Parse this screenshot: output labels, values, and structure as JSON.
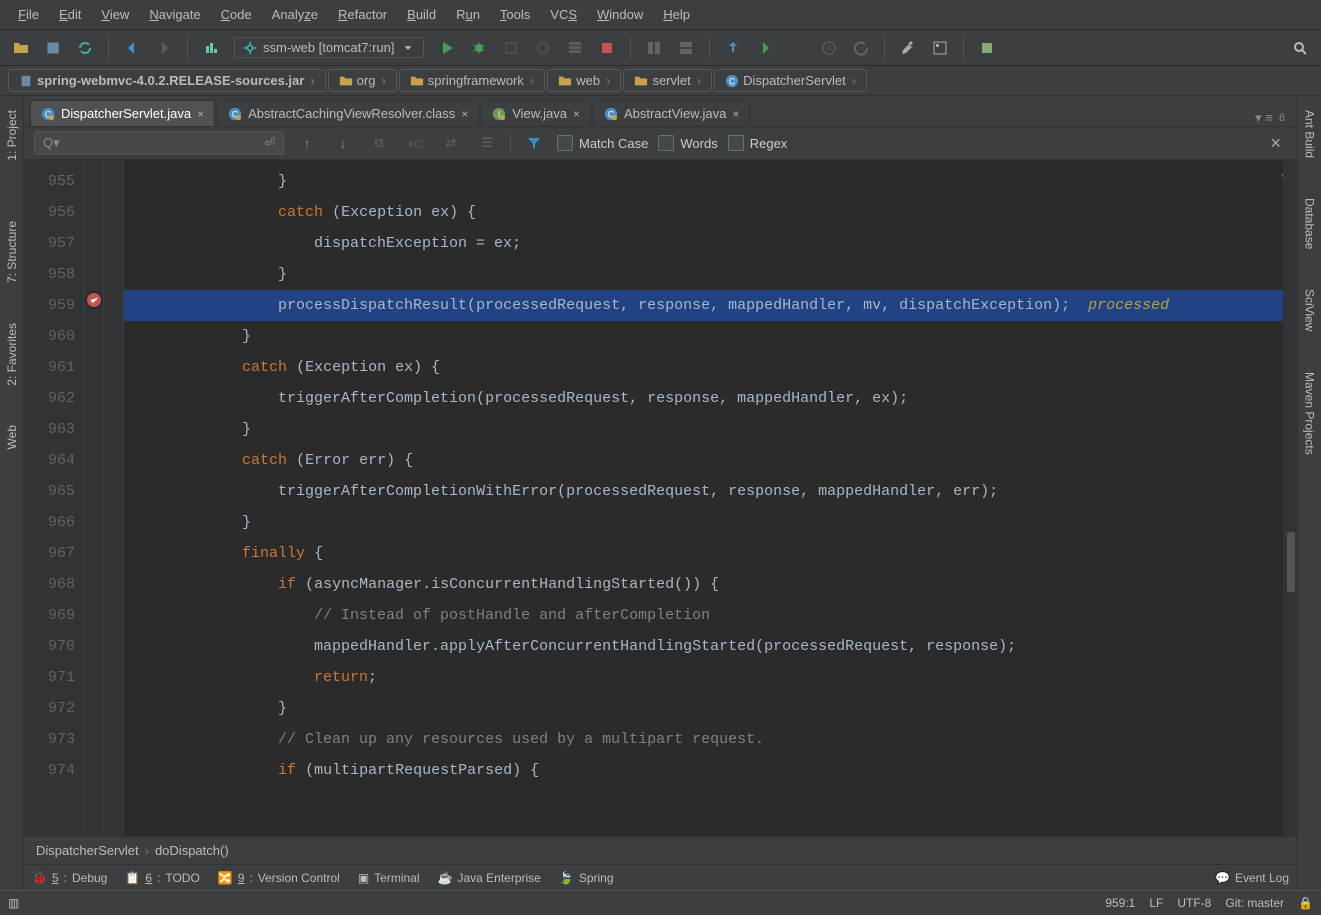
{
  "menu": {
    "file": "File",
    "edit": "Edit",
    "view": "View",
    "navigate": "Navigate",
    "code": "Code",
    "analyze": "Analyze",
    "refactor": "Refactor",
    "build": "Build",
    "run": "Run",
    "tools": "Tools",
    "vcs": "VCS",
    "window": "Window",
    "help": "Help"
  },
  "runConfig": {
    "label": "ssm-web [tomcat7:run]"
  },
  "breadcrumbs": [
    {
      "label": "spring-webmvc-4.0.2.RELEASE-sources.jar",
      "icon": "jar"
    },
    {
      "label": "org",
      "icon": "folder"
    },
    {
      "label": "springframework",
      "icon": "folder"
    },
    {
      "label": "web",
      "icon": "folder"
    },
    {
      "label": "servlet",
      "icon": "folder"
    },
    {
      "label": "DispatcherServlet",
      "icon": "class"
    }
  ],
  "tabs": [
    {
      "label": "DispatcherServlet.java",
      "active": true,
      "icon": "class-lock"
    },
    {
      "label": "AbstractCachingViewResolver.class",
      "active": false,
      "icon": "class-lock"
    },
    {
      "label": "View.java",
      "active": false,
      "icon": "interface-lock"
    },
    {
      "label": "AbstractView.java",
      "active": false,
      "icon": "class-lock"
    }
  ],
  "search": {
    "placeholder": "",
    "matchCase": "Match Case",
    "words": "Words",
    "regex": "Regex"
  },
  "code": {
    "startLine": 955,
    "lines": [
      {
        "n": 955,
        "ind": 16,
        "html": "<span class='pun'>}</span>"
      },
      {
        "n": 956,
        "ind": 16,
        "html": "<span class='kw'>catch</span> <span class='pun'>(Exception ex) {</span>"
      },
      {
        "n": 957,
        "ind": 20,
        "html": "<span class='txt'>dispatchException = ex;</span>"
      },
      {
        "n": 958,
        "ind": 16,
        "html": "<span class='pun'>}</span>"
      },
      {
        "n": 959,
        "ind": 16,
        "hl": true,
        "mark": "error",
        "html": "<span class='txt'>processDispatchResult(processedRequest, response, mappedHandler, mv, dispatchException);  </span><span class='str-hint'>processed</span>"
      },
      {
        "n": 960,
        "ind": 12,
        "html": "<span class='pun'>}</span>"
      },
      {
        "n": 961,
        "ind": 12,
        "html": "<span class='kw'>catch</span> <span class='pun'>(Exception ex) {</span>"
      },
      {
        "n": 962,
        "ind": 16,
        "html": "<span class='txt'>triggerAfterCompletion(processedRequest, response, mappedHandler, ex);</span>"
      },
      {
        "n": 963,
        "ind": 12,
        "html": "<span class='pun'>}</span>"
      },
      {
        "n": 964,
        "ind": 12,
        "html": "<span class='kw'>catch</span> <span class='pun'>(Error err) {</span>"
      },
      {
        "n": 965,
        "ind": 16,
        "html": "<span class='txt'>triggerAfterCompletionWithError(processedRequest, response, mappedHandler, err);</span>"
      },
      {
        "n": 966,
        "ind": 12,
        "html": "<span class='pun'>}</span>"
      },
      {
        "n": 967,
        "ind": 12,
        "html": "<span class='kw'>finally</span> <span class='pun'>{</span>"
      },
      {
        "n": 968,
        "ind": 16,
        "html": "<span class='kw'>if</span> <span class='pun'>(asyncManager.isConcurrentHandlingStarted()) {</span>"
      },
      {
        "n": 969,
        "ind": 20,
        "html": "<span class='cmt'>// Instead of postHandle and afterCompletion</span>"
      },
      {
        "n": 970,
        "ind": 20,
        "html": "<span class='txt'>mappedHandler.applyAfterConcurrentHandlingStarted(processedRequest, response);</span>"
      },
      {
        "n": 971,
        "ind": 20,
        "html": "<span class='kw'>return</span><span class='pun'>;</span>"
      },
      {
        "n": 972,
        "ind": 16,
        "html": "<span class='pun'>}</span>"
      },
      {
        "n": 973,
        "ind": 16,
        "html": "<span class='cmt'>// Clean up any resources used by a multipart request.</span>"
      },
      {
        "n": 974,
        "ind": 16,
        "html": "<span class='kw'>if</span> <span class='pun'>(multipartRequestParsed) {</span>"
      }
    ]
  },
  "crumbPath": {
    "class": "DispatcherServlet",
    "method": "doDispatch()"
  },
  "toolWindows": {
    "debug": "5: Debug",
    "todo": "6: TODO",
    "vcs": "9: Version Control",
    "terminal": "Terminal",
    "javaee": "Java Enterprise",
    "spring": "Spring",
    "eventlog": "Event Log"
  },
  "rightTools": {
    "ant": "Ant Build",
    "db": "Database",
    "sci": "SciView",
    "maven": "Maven Projects"
  },
  "leftTools": {
    "project": "1: Project",
    "structure": "7: Structure",
    "favorites": "2: Favorites",
    "web": "Web"
  },
  "status": {
    "pos": "959:1",
    "enc": "UTF-8",
    "branch": "Git: master"
  }
}
